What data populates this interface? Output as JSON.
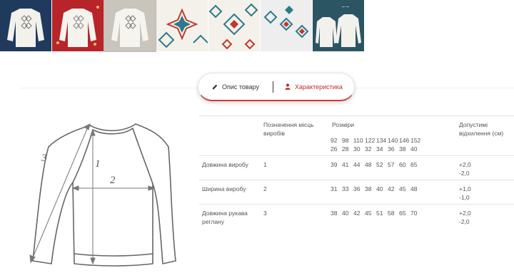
{
  "gallery": {
    "thumbnails": [
      {
        "name": "sweater-navy-bg",
        "bg": "#1f3a5c"
      },
      {
        "name": "sweater-red-bg",
        "bg": "#b7242a"
      },
      {
        "name": "sweater-grey-bg",
        "bg": "#c9c4bc"
      },
      {
        "name": "ornament-detail-1",
        "bg": "#f4f1ea"
      },
      {
        "name": "ornament-detail-2",
        "bg": "#f4f1ea"
      },
      {
        "name": "ornament-detail-3",
        "bg": "#eeeeee"
      },
      {
        "name": "sweater-pair-teal",
        "bg": "#2b5563"
      }
    ]
  },
  "tabs": {
    "description": "Опис товару",
    "characteristics": "Характеристика"
  },
  "diagram": {
    "label1": "1",
    "label2": "2",
    "label3": "3"
  },
  "table": {
    "col_mark": "Позначення місць виробів",
    "col_sizes": "Розміри",
    "col_tolerance": "Допустимі відхилення (см)",
    "sizes_top": [
      "92",
      "98",
      "110",
      "122",
      "134",
      "140",
      "146",
      "152"
    ],
    "sizes_bottom": [
      "26",
      "28",
      "30",
      "32",
      "34",
      "36",
      "38",
      "40"
    ],
    "rows": [
      {
        "name": "Довжина виробу",
        "mark": "1",
        "values": [
          "39",
          "41",
          "44",
          "48",
          "52",
          "57",
          "60",
          "65"
        ],
        "tol_plus": "+2,0",
        "tol_minus": "-2,0"
      },
      {
        "name": "Ширина виробу",
        "mark": "2",
        "values": [
          "31",
          "33",
          "36",
          "38",
          "40",
          "42",
          "45",
          "48"
        ],
        "tol_plus": "+1,0",
        "tol_minus": "-1,0"
      },
      {
        "name": "Довжина рукава реглану",
        "mark": "3",
        "values": [
          "38",
          "40",
          "42",
          "45",
          "51",
          "58",
          "65",
          "70"
        ],
        "tol_plus": "+2,0",
        "tol_minus": "-2,0"
      }
    ]
  },
  "colors": {
    "accent": "#c62828",
    "text": "#555555",
    "border": "#e3e3e3"
  }
}
